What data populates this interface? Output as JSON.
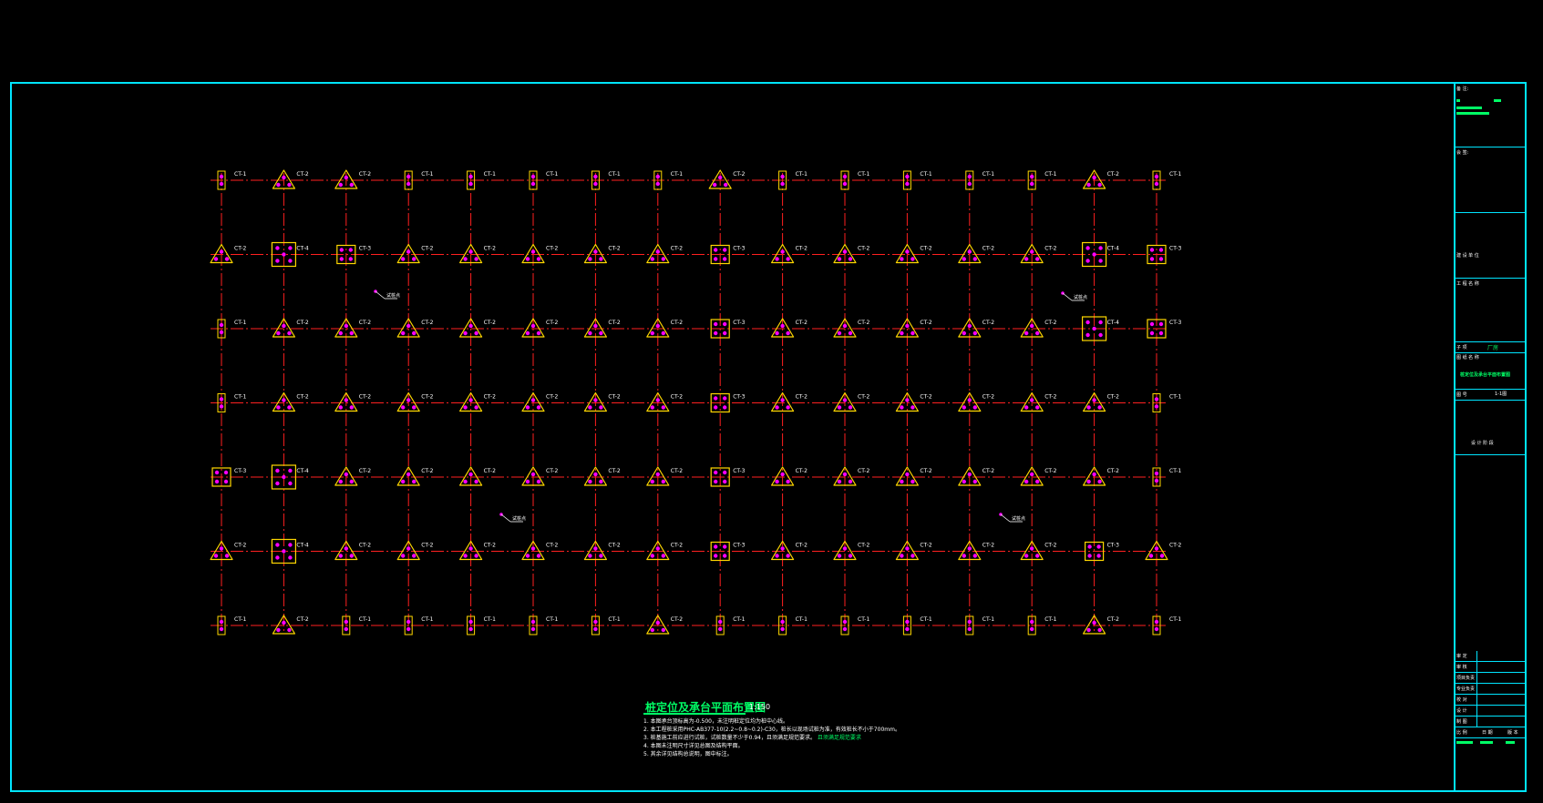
{
  "drawing": {
    "title": "桩定位及承台平面布置图",
    "scale": "1:150",
    "notes": [
      "1. 本图承台顶标高为-0.500，未注明桩定位均为桩中心线。",
      "2. 本工程桩采用PHC-AB377-10(2.2~0.8~0.2)-C30，桩长以现场试桩为准，有效桩长不小于700mm。",
      "3. 桩基施工前应进行试桩，试桩数量不少于0.94，且须满足规范要求。",
      "4. 本图未注明尺寸详见总图及结构平面。",
      "5. 其余详见结构总说明，图中标注。"
    ],
    "note_highlight": "且须满足规范要求",
    "callout_label": "试桩点"
  },
  "grid": {
    "rows": [
      [
        "CT-1",
        "CT-2",
        "CT-2",
        "CT-1",
        "CT-1",
        "CT-1",
        "CT-1",
        "CT-1",
        "CT-2",
        "CT-1",
        "CT-1",
        "CT-1",
        "CT-1",
        "CT-1",
        "CT-2",
        "CT-1"
      ],
      [
        "CT-2",
        "CT-4",
        "CT-3",
        "CT-2",
        "CT-2",
        "CT-2",
        "CT-2",
        "CT-2",
        "CT-3",
        "CT-2",
        "CT-2",
        "CT-2",
        "CT-2",
        "CT-2",
        "CT-4",
        "CT-3"
      ],
      [
        "CT-1",
        "CT-2",
        "CT-2",
        "CT-2",
        "CT-2",
        "CT-2",
        "CT-2",
        "CT-2",
        "CT-3",
        "CT-2",
        "CT-2",
        "CT-2",
        "CT-2",
        "CT-2",
        "CT-4",
        "CT-3"
      ],
      [
        "CT-1",
        "CT-2",
        "CT-2",
        "CT-2",
        "CT-2",
        "CT-2",
        "CT-2",
        "CT-2",
        "CT-3",
        "CT-2",
        "CT-2",
        "CT-2",
        "CT-2",
        "CT-2",
        "CT-2",
        "CT-1"
      ],
      [
        "CT-3",
        "CT-4",
        "CT-2",
        "CT-2",
        "CT-2",
        "CT-2",
        "CT-2",
        "CT-2",
        "CT-3",
        "CT-2",
        "CT-2",
        "CT-2",
        "CT-2",
        "CT-2",
        "CT-2",
        "CT-1"
      ],
      [
        "CT-2",
        "CT-4",
        "CT-2",
        "CT-2",
        "CT-2",
        "CT-2",
        "CT-2",
        "CT-2",
        "CT-3",
        "CT-2",
        "CT-2",
        "CT-2",
        "CT-2",
        "CT-2",
        "CT-3",
        "CT-2"
      ],
      [
        "CT-1",
        "CT-2",
        "CT-1",
        "CT-1",
        "CT-1",
        "CT-1",
        "CT-1",
        "CT-2",
        "CT-1",
        "CT-1",
        "CT-1",
        "CT-1",
        "CT-1",
        "CT-1",
        "CT-2",
        "CT-1"
      ]
    ]
  },
  "title_block": {
    "remark_label": "备 注:",
    "signature_label": "会 签:",
    "construction_unit_label": "建 设 单 位",
    "project_label": "工 程 名 称",
    "item_label": "子 项",
    "item_value": "厂房",
    "drawing_name_label": "图 纸 名 称",
    "drawing_name_value": "桩定位及承台平面布置图",
    "drawing_no_label": "图 号",
    "drawing_no_value": "1-1图",
    "stage_label": "设 计 阶 段",
    "rows": [
      "审 定",
      "审 核",
      "项目负责",
      "专业负责",
      "校 对",
      "设 计",
      "制 图"
    ],
    "bottom": [
      "比 例",
      "日 期",
      "版 本"
    ]
  },
  "colors": {
    "border": "#00e5ff",
    "grid_line": "#ff2020",
    "pile_cap": "#ffd700",
    "pile": "#ff00ff",
    "label": "#ffffff",
    "title_text": "#00ff66"
  }
}
